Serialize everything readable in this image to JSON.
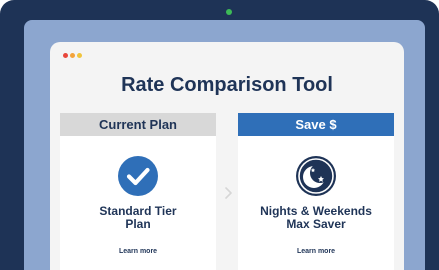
{
  "app": {
    "title": "Rate Comparison Tool"
  },
  "plans": [
    {
      "header": "Current Plan",
      "name_line1": "Standard Tier",
      "name_line2": "Plan",
      "link": "Learn more",
      "icon": "checkmark-circle-icon"
    },
    {
      "header": "Save $",
      "name_line1": "Nights & Weekends",
      "name_line2": "Max Saver",
      "link": "Learn more",
      "icon": "moon-stars-icon"
    }
  ],
  "colors": {
    "frame": "#1e3356",
    "screen": "#8ca6cf",
    "accent": "#2f6fb8",
    "text": "#1f3457"
  }
}
